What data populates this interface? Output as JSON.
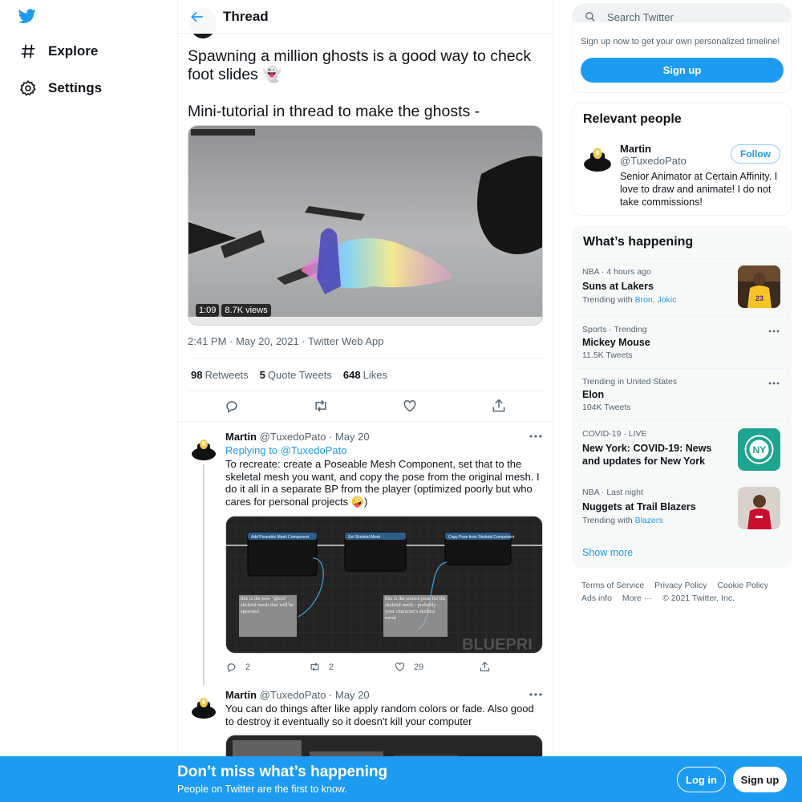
{
  "nav": {
    "items": [
      {
        "label": "Explore",
        "icon": "hashtag-icon"
      },
      {
        "label": "Settings",
        "icon": "gear-icon"
      }
    ]
  },
  "header": {
    "title": "Thread"
  },
  "main_tweet": {
    "text_line1": "Spawning a million ghosts is a good way to check foot slides 👻",
    "text_line2": "Mini-tutorial in thread to make the ghosts -",
    "video_duration": "1:09",
    "video_views": "8.7K views",
    "meta": "2:41 PM · May 20, 2021 · Twitter Web App",
    "stats": {
      "retweets_count": "98",
      "retweets_label": "Retweets",
      "quotes_count": "5",
      "quotes_label": "Quote Tweets",
      "likes_count": "648",
      "likes_label": "Likes"
    }
  },
  "replies": [
    {
      "name": "Martin",
      "handle": "@TuxedoPato · May 20",
      "replying_prefix": "Replying to ",
      "replying_handle": "@TuxedoPato",
      "text": "To recreate: create a Poseable Mesh Component, set that to the skeletal mesh you want, and copy the pose from the original mesh. I do it all in a separate BP from the player (optimized poorly but who cares for personal projects 🤪)",
      "reply_count": "2",
      "retweet_count": "2",
      "like_count": "29",
      "blueprint": {
        "node1": "Add Poseable Mesh Component",
        "node2": "Set Skeletal Mesh",
        "node3": "Copy Pose from Skeletal Component",
        "note1": "this is the new \"ghost\" skeletal mesh that will be spawned",
        "note2": "this is the source pose for the skeletal mesh - probably your character's skeletal mesh",
        "watermark": "BLUEPRI"
      }
    },
    {
      "name": "Martin",
      "handle": "@TuxedoPato · May 20",
      "text": "You can do things after like apply random colors or fade. Also good to destroy it eventually so it doesn't kill your computer"
    }
  ],
  "sidebar": {
    "search_placeholder": "Search Twitter",
    "signup_text": "Sign up now to get your own personalized timeline!",
    "signup_button": "Sign up",
    "relevant": {
      "title": "Relevant people",
      "name": "Martin",
      "handle": "@TuxedoPato",
      "follow": "Follow",
      "bio": "Senior Animator at Certain Affinity. I love to draw and animate! I do not take commissions!"
    },
    "happening": {
      "title": "What’s happening",
      "trends": [
        {
          "category": "NBA · 4 hours ago",
          "name": "Suns at Lakers",
          "sub_prefix": "Trending with ",
          "sub_links": "Bron, Jokic",
          "image": "lakers-player-image"
        },
        {
          "category": "Sports · Trending",
          "name": "Mickey Mouse",
          "sub": "11.5K Tweets"
        },
        {
          "category": "Trending in United States",
          "name": "Elon",
          "sub": "104K Tweets"
        },
        {
          "category": "COVID-19 · LIVE",
          "name": "New York: COVID-19: News and updates for New York",
          "image": "ny-badge-image"
        },
        {
          "category": "NBA · Last night",
          "name": "Nuggets at Trail Blazers",
          "sub_prefix": "Trending with ",
          "sub_links": "Blazers",
          "image": "blazers-player-image"
        }
      ],
      "show_more": "Show more"
    },
    "footer": {
      "terms": "Terms of Service",
      "privacy": "Privacy Policy",
      "cookie": "Cookie Policy",
      "ads": "Ads info",
      "more": "More ···",
      "copyright": "© 2021 Twitter, Inc."
    }
  },
  "banner": {
    "title": "Don’t miss what’s happening",
    "subtitle": "People on Twitter are the first to know.",
    "login": "Log in",
    "signup": "Sign up"
  },
  "colors": {
    "accent": "#1d9bf0",
    "text": "#0f1419",
    "muted": "#536471",
    "border": "#eff3f4"
  }
}
